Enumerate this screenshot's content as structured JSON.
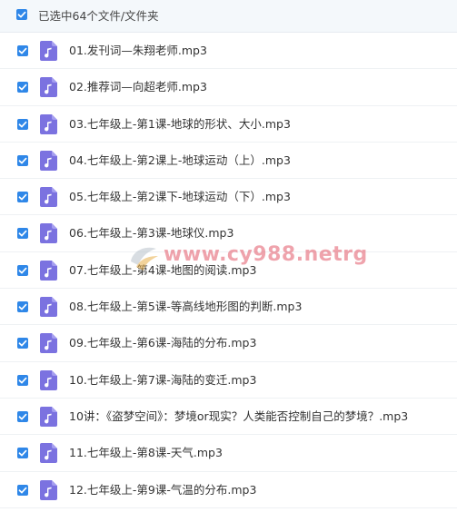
{
  "header": {
    "selection_text": "已选中64个文件/文件夹",
    "select_all_checked": true
  },
  "colors": {
    "checkbox": "#2f87e8",
    "music_icon": "#7b72e0",
    "header_bg": "#f4f8fb"
  },
  "icons": {
    "checkbox": "check-icon",
    "file": "music-file-icon"
  },
  "files": [
    {
      "name": "01.发刊词—朱翔老师.mp3",
      "checked": true
    },
    {
      "name": "02.推荐词—向超老师.mp3",
      "checked": true
    },
    {
      "name": "03.七年级上-第1课-地球的形状、大小.mp3",
      "checked": true
    },
    {
      "name": "04.七年级上-第2课上-地球运动（上）.mp3",
      "checked": true
    },
    {
      "name": "05.七年级上-第2课下-地球运动（下）.mp3",
      "checked": true
    },
    {
      "name": "06.七年级上-第3课-地球仪.mp3",
      "checked": true
    },
    {
      "name": "07.七年级上-第4课-地图的阅读.mp3",
      "checked": true
    },
    {
      "name": "08.七年级上-第5课-等高线地形图的判断.mp3",
      "checked": true
    },
    {
      "name": "09.七年级上-第6课-海陆的分布.mp3",
      "checked": true
    },
    {
      "name": "10.七年级上-第7课-海陆的变迁.mp3",
      "checked": true
    },
    {
      "name": "10讲：《盗梦空间》：梦境or现实？人类能否控制自己的梦境？.mp3",
      "checked": true
    },
    {
      "name": "11.七年级上-第8课-天气.mp3",
      "checked": true
    },
    {
      "name": "12.七年级上-第9课-气温的分布.mp3",
      "checked": true
    }
  ],
  "watermark": {
    "text": "www.cy988.netrg"
  }
}
